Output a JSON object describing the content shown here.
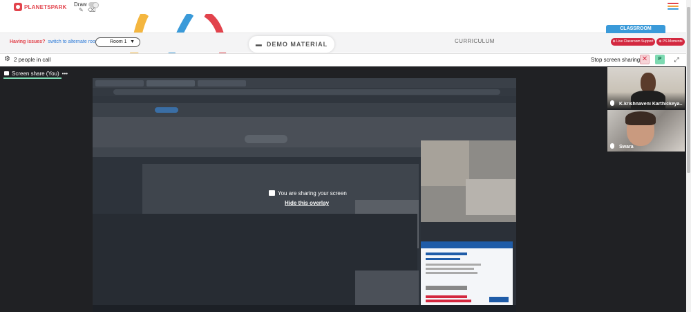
{
  "app": {
    "logo_text": "PLANETSPARK",
    "draw_label": "Draw"
  },
  "colors": {
    "brand_red": "#e2434c",
    "link_blue": "#2d7bd8",
    "classroom_blue": "#3a9ad9",
    "accent_green": "#7ddab2",
    "stage_bg": "#202124"
  },
  "header": {
    "issues_text": "Having issues?",
    "alternate_room_link": "switch to alternate room",
    "room_select_value": "Room 1",
    "demo_material_label": "DEMO MATERIAL",
    "curriculum_label": "CURRICULUM",
    "classroom_tab": "CLASSROOM",
    "live_support_button": "Live Classroom Support",
    "ps_moments_button": "PS Moments"
  },
  "callbar": {
    "people_count": "2 people in call",
    "stop_sharing": "Stop screen sharing",
    "participant_initial": "P"
  },
  "stage": {
    "share_tab_label": "Screen share (You)",
    "overlay_title": "You are sharing your screen",
    "overlay_hide_link": "Hide this overlay"
  },
  "participants": [
    {
      "name": "K.krishnaveni Karthickeya..."
    },
    {
      "name": "Swara"
    }
  ],
  "icons": [
    "settings-gear-icon",
    "close-icon",
    "expand-icon",
    "folder-icon",
    "pencil-icon",
    "eraser-icon",
    "hamburger-icon",
    "microphone-icon",
    "present-screen-icon",
    "more-dots-icon"
  ]
}
